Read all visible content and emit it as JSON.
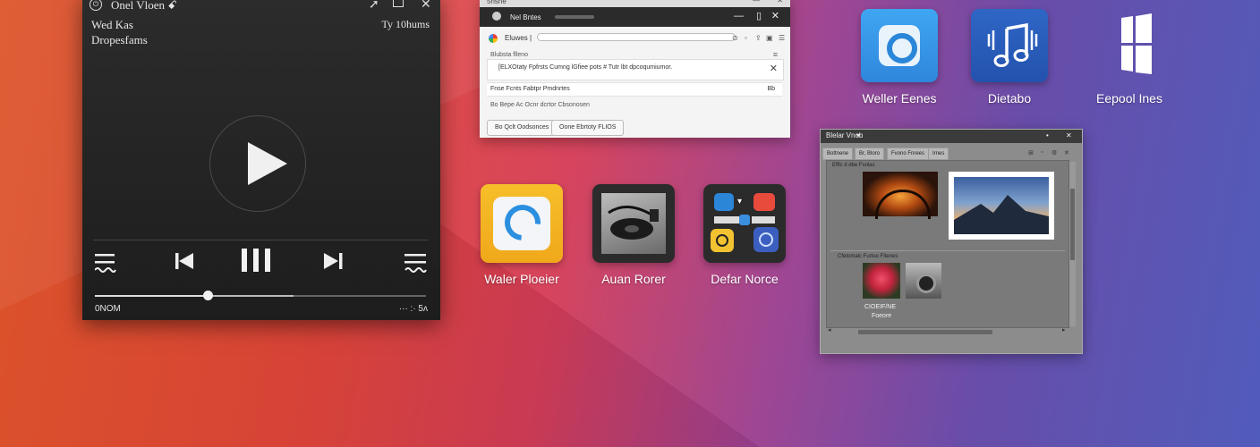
{
  "player": {
    "title": "Onel Vloen",
    "title_suffix": "ꗃ",
    "line1": "Wed Kas",
    "line2": "Dropesfams",
    "time_top": "Ty 10hums",
    "time_left": "0NOM",
    "time_right": "··· :· 5ʌ",
    "progress": 0.34,
    "buffered": 0.6
  },
  "browser": {
    "outer_title": "5hsne",
    "window_title": "Nel Bntes",
    "addr_label": "Eluwes",
    "addr_value": "|",
    "tab_label": "Blubsta flleno",
    "notice_text": "[ELXOtaty Fpfrsts Cumng lGfiee pots # Tutr lbt dpcoqumiumor.",
    "row_text": "Fnse Fcnts Fabtpr Pmdnrtes",
    "row_value": "Bb",
    "desc_text": "Bo  Bepe Ac Ocnr dcrtor  Cbsonosen",
    "button1": "Bo  Qclt Oodsonces",
    "button2": "Oone Ebrtoty FLIOS"
  },
  "icons": {
    "weller": "Weller Eenes",
    "dietabo": "Dietabo",
    "eepool": "Eepool Ines",
    "water": "Waler Ploeier",
    "audio": "Auan Rorer",
    "defar": "Defar Norce"
  },
  "viewer": {
    "title": "Blelar Vnob",
    "tab1": "Bottnene",
    "tab2": "Br, Bloro",
    "tab3": "Fvono Fnrees",
    "tab4": "Irnes",
    "section1": "Efflc d dbe Fsnlas",
    "section2": "Cfetomalc Furtoo Fltenes",
    "caption1": "CIOEIF/NE",
    "caption2": "Foeore"
  }
}
